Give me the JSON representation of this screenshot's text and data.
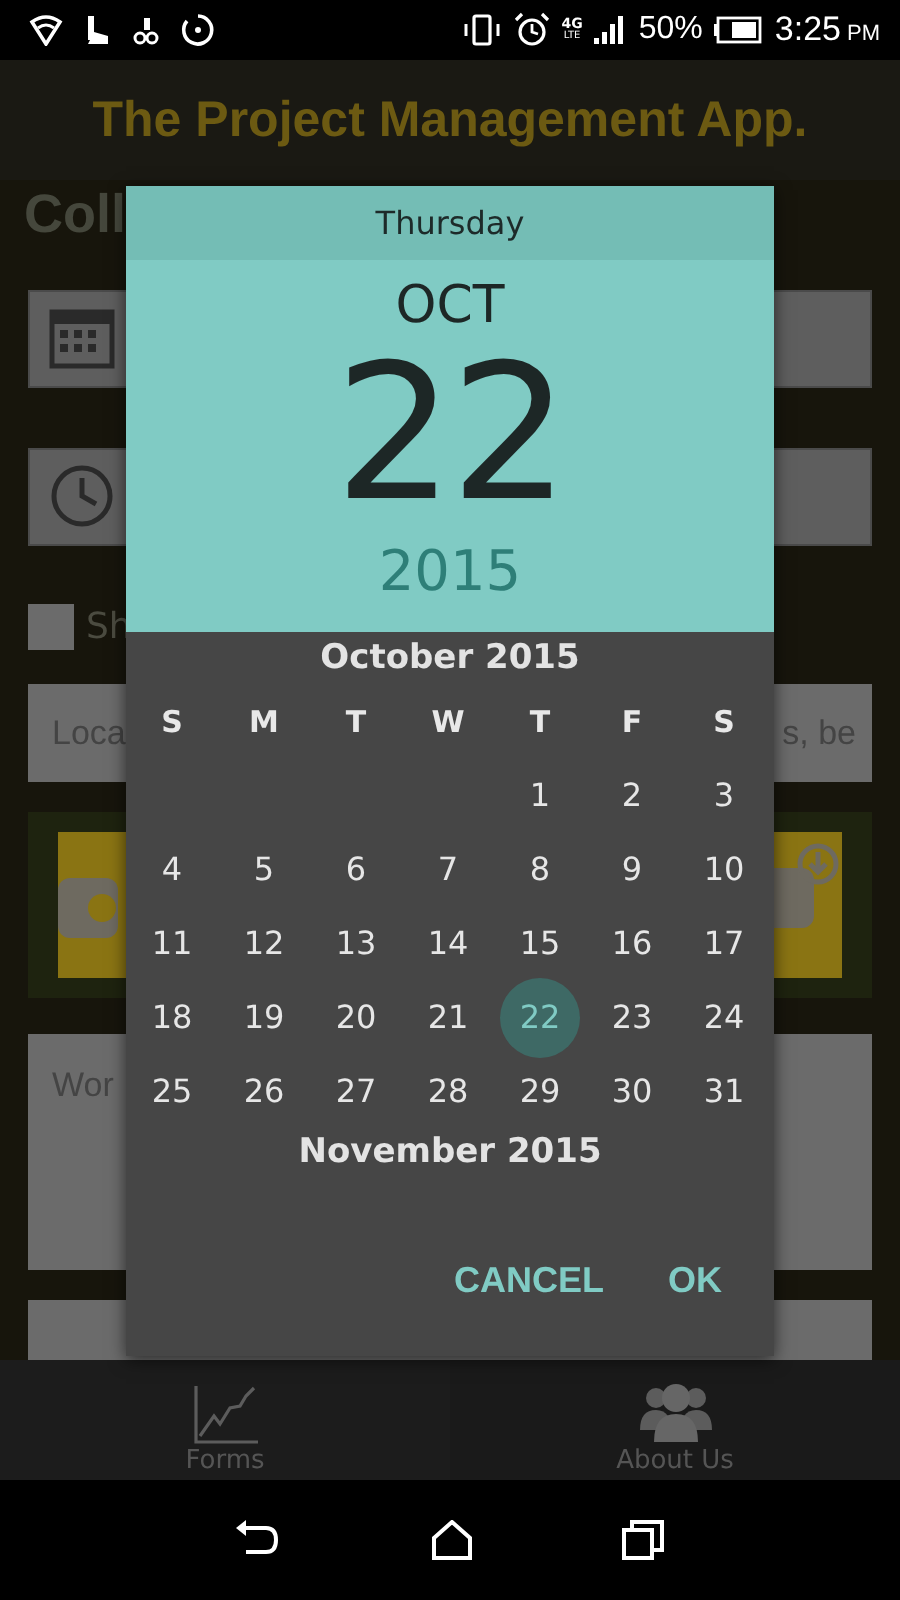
{
  "status_bar": {
    "network": "4G",
    "network_sub": "LTE",
    "battery": "50%",
    "time": "3:25",
    "time_suffix": "PM"
  },
  "app_bar": {
    "title": "The Project Management App."
  },
  "form": {
    "heading": "Coll",
    "checkbox": {
      "label": "Sh",
      "checked": false
    },
    "location_field": {
      "placeholder_start": "Loca",
      "placeholder_end": "s, be"
    },
    "description_field": {
      "placeholder": "Wor"
    }
  },
  "date_picker": {
    "day_of_week": "Thursday",
    "month": "OCT",
    "date": "22",
    "year": "2015",
    "month_label": "October 2015",
    "weekdays": [
      "S",
      "M",
      "T",
      "W",
      "T",
      "F",
      "S"
    ],
    "weeks": [
      [
        {
          "day": "1",
          "selected": false
        },
        {
          "day": "2",
          "selected": false
        },
        {
          "day": "3",
          "selected": false
        }
      ],
      [
        {
          "day": "4",
          "selected": false
        },
        {
          "day": "5",
          "selected": false
        },
        {
          "day": "6",
          "selected": false
        },
        {
          "day": "7",
          "selected": false
        },
        {
          "day": "8",
          "selected": false
        },
        {
          "day": "9",
          "selected": false
        },
        {
          "day": "10",
          "selected": false
        }
      ],
      [
        {
          "day": "11",
          "selected": false
        },
        {
          "day": "12",
          "selected": false
        },
        {
          "day": "13",
          "selected": false
        },
        {
          "day": "14",
          "selected": false
        },
        {
          "day": "15",
          "selected": false
        },
        {
          "day": "16",
          "selected": false
        },
        {
          "day": "17",
          "selected": false
        }
      ],
      [
        {
          "day": "18",
          "selected": false
        },
        {
          "day": "19",
          "selected": false
        },
        {
          "day": "20",
          "selected": false
        },
        {
          "day": "21",
          "selected": false
        },
        {
          "day": "22",
          "selected": true
        },
        {
          "day": "23",
          "selected": false
        },
        {
          "day": "24",
          "selected": false
        }
      ],
      [
        {
          "day": "25",
          "selected": false
        },
        {
          "day": "26",
          "selected": false
        },
        {
          "day": "27",
          "selected": false
        },
        {
          "day": "28",
          "selected": false
        },
        {
          "day": "29",
          "selected": false
        },
        {
          "day": "30",
          "selected": false
        },
        {
          "day": "31",
          "selected": false
        }
      ]
    ],
    "next_month_label": "November 2015",
    "buttons": [
      "CANCEL",
      "OK"
    ]
  },
  "bottom_nav": {
    "items": [
      {
        "label": "Forms",
        "selected": false
      },
      {
        "label": "About Us",
        "selected": false
      }
    ]
  }
}
